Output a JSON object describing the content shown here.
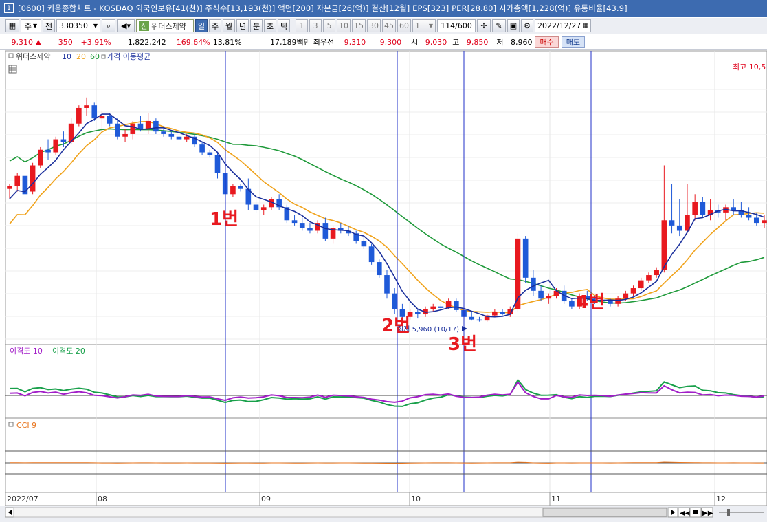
{
  "window": {
    "number": "1",
    "title": "[0600] 키움종합차트 - KOSDAQ 외국인보유[41(천)] 주식수[13,193(천)] 액면[200] 자본금[26(억)] 결산[12월] EPS[323] PER[28.80] 시가총액[1,228(억)] 유통비율[43.9]"
  },
  "toolbar": {
    "market": "주",
    "period_all": "전",
    "code": "330350",
    "stock_badge": "신",
    "stock_name": "위더스제약",
    "period_buttons": [
      "일",
      "주",
      "월",
      "년",
      "분",
      "초",
      "틱"
    ],
    "selected_period": "일",
    "interval_buttons": [
      "1",
      "3",
      "5",
      "10",
      "15",
      "30",
      "45",
      "60"
    ],
    "interval_value": "1",
    "page_count": "114/600",
    "date": "2022/12/27"
  },
  "quote": {
    "price": "9,310",
    "change": "350",
    "change_rate": "+3.91%",
    "volume": "1,822,242",
    "volume_ratio": "169.64%",
    "turnover": "13.81%",
    "amount": "17,189백만",
    "best_bid_label": "최우선",
    "best_ask": "9,310",
    "best_bid": "9,300",
    "open_label": "시",
    "open": "9,030",
    "high_label": "고",
    "high": "9,850",
    "low_label": "저",
    "low": "8,960",
    "buy_label": "매수",
    "sell_label": "매도"
  },
  "legend": {
    "stock": "위더스제약",
    "ma10": "10",
    "ma20": "20",
    "ma60": "60",
    "ma_title": "가격 이동평균",
    "high_marker": "최고 10,5",
    "low_marker": "최저 5,960 (10/17)"
  },
  "annotations": [
    "1번",
    "2번",
    "3번",
    "4번"
  ],
  "disparity_legend": {
    "d10": "이격도 10",
    "d20": "이격도 20"
  },
  "cci_legend": "CCI 9",
  "xaxis_labels": [
    "2022/07",
    "08",
    "09",
    "10",
    "11",
    "12"
  ],
  "colors": {
    "up": "#e8191f",
    "down": "#1f5ad8",
    "ma10": "#1a2f9c",
    "ma20": "#f0a21a",
    "ma60": "#1f9a3a",
    "disp10": "#a21ec8",
    "disp20": "#18a04a",
    "cci": "#e8741c",
    "cci_pos": "#f2a07f",
    "cci_neg": "#9fd6ee"
  },
  "chart_data": {
    "type": "candlestick",
    "candles": [
      [
        8500,
        8600,
        8300,
        8550
      ],
      [
        8550,
        8800,
        8450,
        8750
      ],
      [
        8750,
        8700,
        8500,
        8400
      ],
      [
        8450,
        9000,
        8400,
        8950
      ],
      [
        8950,
        9300,
        8900,
        9250
      ],
      [
        9250,
        9450,
        9050,
        9200
      ],
      [
        9200,
        9500,
        9150,
        9450
      ],
      [
        9450,
        9600,
        9300,
        9400
      ],
      [
        9400,
        9850,
        9350,
        9750
      ],
      [
        9750,
        10100,
        9700,
        10050
      ],
      [
        10050,
        10250,
        9900,
        10100
      ],
      [
        10100,
        10150,
        9800,
        9850
      ],
      [
        9850,
        10000,
        9600,
        9900
      ],
      [
        9900,
        9950,
        9700,
        9750
      ],
      [
        9750,
        9850,
        9450,
        9500
      ],
      [
        9500,
        9650,
        9400,
        9550
      ],
      [
        9550,
        9800,
        9450,
        9750
      ],
      [
        9750,
        9900,
        9600,
        9650
      ],
      [
        9650,
        9950,
        9550,
        9800
      ],
      [
        9800,
        9850,
        9550,
        9600
      ],
      [
        9600,
        9700,
        9500,
        9550
      ],
      [
        9550,
        9600,
        9450,
        9500
      ],
      [
        9500,
        9550,
        9350,
        9450
      ],
      [
        9450,
        9550,
        9400,
        9500
      ],
      [
        9500,
        9550,
        9300,
        9350
      ],
      [
        9350,
        9400,
        9150,
        9200
      ],
      [
        9200,
        9250,
        9100,
        9150
      ],
      [
        9150,
        9200,
        8700,
        8800
      ],
      [
        8800,
        8850,
        8300,
        8400
      ],
      [
        8400,
        8600,
        8350,
        8550
      ],
      [
        8550,
        8600,
        8450,
        8500
      ],
      [
        8500,
        8700,
        8100,
        8200
      ],
      [
        8200,
        8300,
        8050,
        8100
      ],
      [
        8100,
        8200,
        8000,
        8150
      ],
      [
        8150,
        8350,
        8100,
        8300
      ],
      [
        8300,
        8400,
        8100,
        8150
      ],
      [
        8150,
        8200,
        7850,
        7900
      ],
      [
        7900,
        8000,
        7800,
        7850
      ],
      [
        7850,
        7950,
        7700,
        7750
      ],
      [
        7750,
        7850,
        7650,
        7700
      ],
      [
        7700,
        7900,
        7650,
        7850
      ],
      [
        7850,
        7950,
        7500,
        7550
      ],
      [
        7550,
        7800,
        7450,
        7750
      ],
      [
        7750,
        7850,
        7650,
        7700
      ],
      [
        7700,
        7800,
        7600,
        7650
      ],
      [
        7650,
        7700,
        7450,
        7500
      ],
      [
        7500,
        7600,
        7350,
        7400
      ],
      [
        7400,
        7450,
        7050,
        7100
      ],
      [
        7100,
        7150,
        6800,
        6850
      ],
      [
        6850,
        6950,
        6400,
        6500
      ],
      [
        6500,
        6600,
        6100,
        6200
      ],
      [
        6200,
        6300,
        6000,
        6050
      ],
      [
        6050,
        6200,
        6000,
        6150
      ],
      [
        6150,
        6200,
        6020,
        6100
      ],
      [
        6100,
        6250,
        6050,
        6200
      ],
      [
        6200,
        6300,
        6150,
        6250
      ],
      [
        6250,
        6300,
        6180,
        6220
      ],
      [
        6220,
        6400,
        6200,
        6350
      ],
      [
        6350,
        6400,
        6150,
        6180
      ],
      [
        6180,
        6250,
        6000,
        6050
      ],
      [
        6050,
        6150,
        5980,
        6000
      ],
      [
        6000,
        6050,
        5960,
        5980
      ],
      [
        5980,
        6100,
        5960,
        6080
      ],
      [
        6080,
        6200,
        6040,
        6150
      ],
      [
        6150,
        6200,
        6080,
        6100
      ],
      [
        6100,
        6250,
        6050,
        6200
      ],
      [
        6200,
        7650,
        6150,
        7550
      ],
      [
        7550,
        7600,
        6700,
        6800
      ],
      [
        6800,
        6950,
        6450,
        6550
      ],
      [
        6550,
        6650,
        6350,
        6400
      ],
      [
        6400,
        6500,
        6300,
        6450
      ],
      [
        6450,
        6600,
        6400,
        6550
      ],
      [
        6550,
        6650,
        6300,
        6350
      ],
      [
        6350,
        6400,
        6200,
        6250
      ],
      [
        6250,
        6500,
        6200,
        6450
      ],
      [
        6450,
        6550,
        6350,
        6400
      ],
      [
        6400,
        6450,
        6300,
        6380
      ],
      [
        6380,
        6450,
        6300,
        6350
      ],
      [
        6350,
        6400,
        6250,
        6300
      ],
      [
        6300,
        6450,
        6250,
        6400
      ],
      [
        6400,
        6550,
        6350,
        6500
      ],
      [
        6500,
        6650,
        6450,
        6600
      ],
      [
        6600,
        6800,
        6550,
        6750
      ],
      [
        6750,
        6900,
        6700,
        6850
      ],
      [
        6850,
        7000,
        6800,
        6950
      ],
      [
        6950,
        8950,
        6900,
        7900
      ],
      [
        7900,
        8600,
        7650,
        7800
      ],
      [
        7800,
        8300,
        7600,
        7700
      ],
      [
        7700,
        8600,
        7650,
        8000
      ],
      [
        8000,
        8400,
        7900,
        8250
      ],
      [
        8250,
        8350,
        7950,
        8000
      ],
      [
        8000,
        8300,
        7900,
        8100
      ],
      [
        8100,
        8200,
        7950,
        8050
      ],
      [
        8050,
        8200,
        7900,
        8150
      ],
      [
        8150,
        8300,
        8000,
        8100
      ],
      [
        8100,
        8250,
        7950,
        8000
      ],
      [
        8000,
        8150,
        7900,
        7950
      ],
      [
        7950,
        8050,
        7800,
        7850
      ],
      [
        7850,
        8000,
        7750,
        7900
      ]
    ],
    "price_range": [
      5600,
      10800
    ]
  }
}
